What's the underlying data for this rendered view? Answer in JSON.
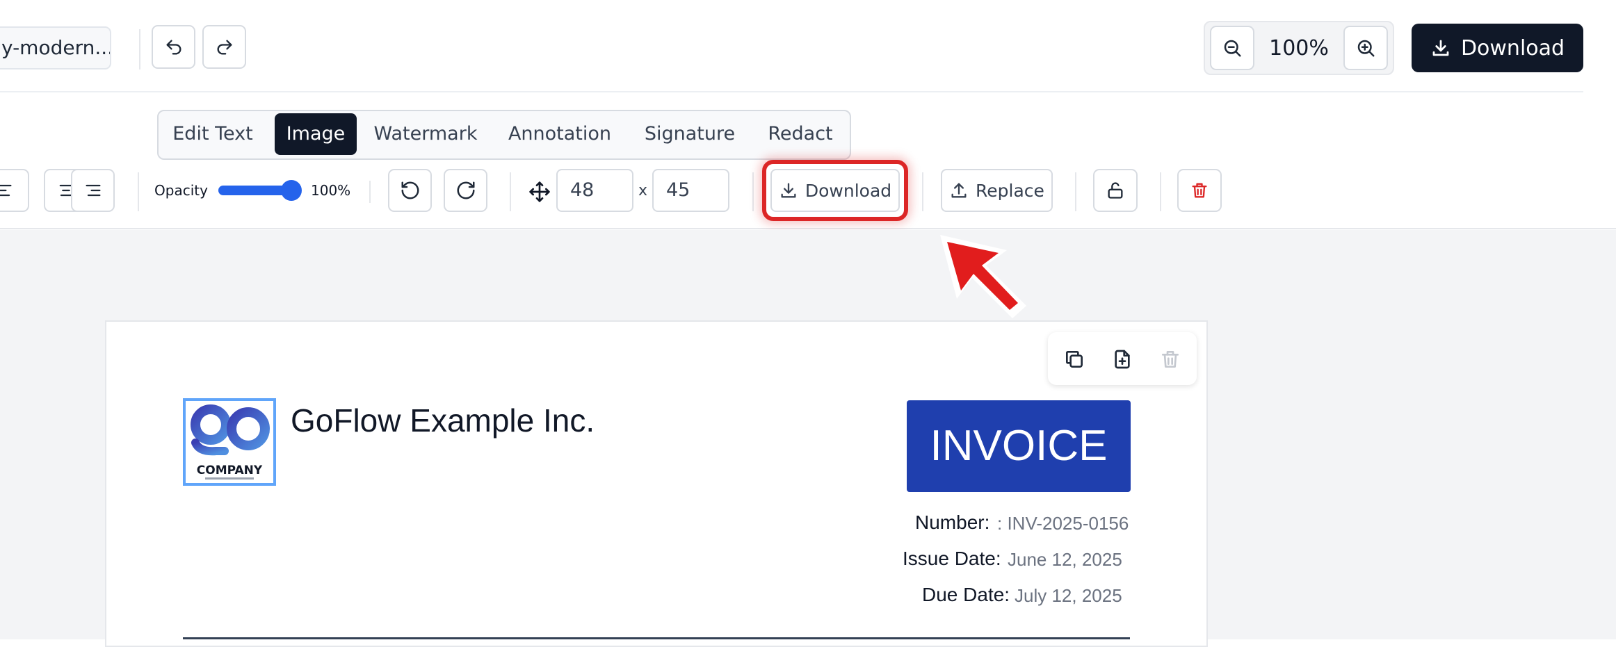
{
  "topbar": {
    "filename": "y-modern...",
    "zoom": "100%",
    "download_label": "Download"
  },
  "tabs": [
    {
      "label": "Edit Text"
    },
    {
      "label": "Image",
      "active": true
    },
    {
      "label": "Watermark"
    },
    {
      "label": "Annotation"
    },
    {
      "label": "Signature"
    },
    {
      "label": "Redact"
    }
  ],
  "image_toolbar": {
    "opacity_label": "Opacity",
    "opacity_value": "100%",
    "opacity_fraction": 1.0,
    "width_value": "48",
    "size_separator": "x",
    "height_value": "45",
    "download_label": "Download",
    "replace_label": "Replace"
  },
  "document": {
    "logo_text": "COMPANY",
    "company_name": "GoFlow Example Inc.",
    "invoice_title": "INVOICE",
    "number_label": "Number:",
    "number_value": ": INV-2025-0156",
    "issue_label": "Issue Date:",
    "issue_value": "June 12, 2025",
    "due_label": "Due Date:",
    "due_value": "July 12, 2025"
  },
  "colors": {
    "accent": "#1f3fae",
    "primary_dark": "#101828",
    "highlight": "#dc2626",
    "slider": "#2563eb",
    "danger": "#dc2626"
  }
}
